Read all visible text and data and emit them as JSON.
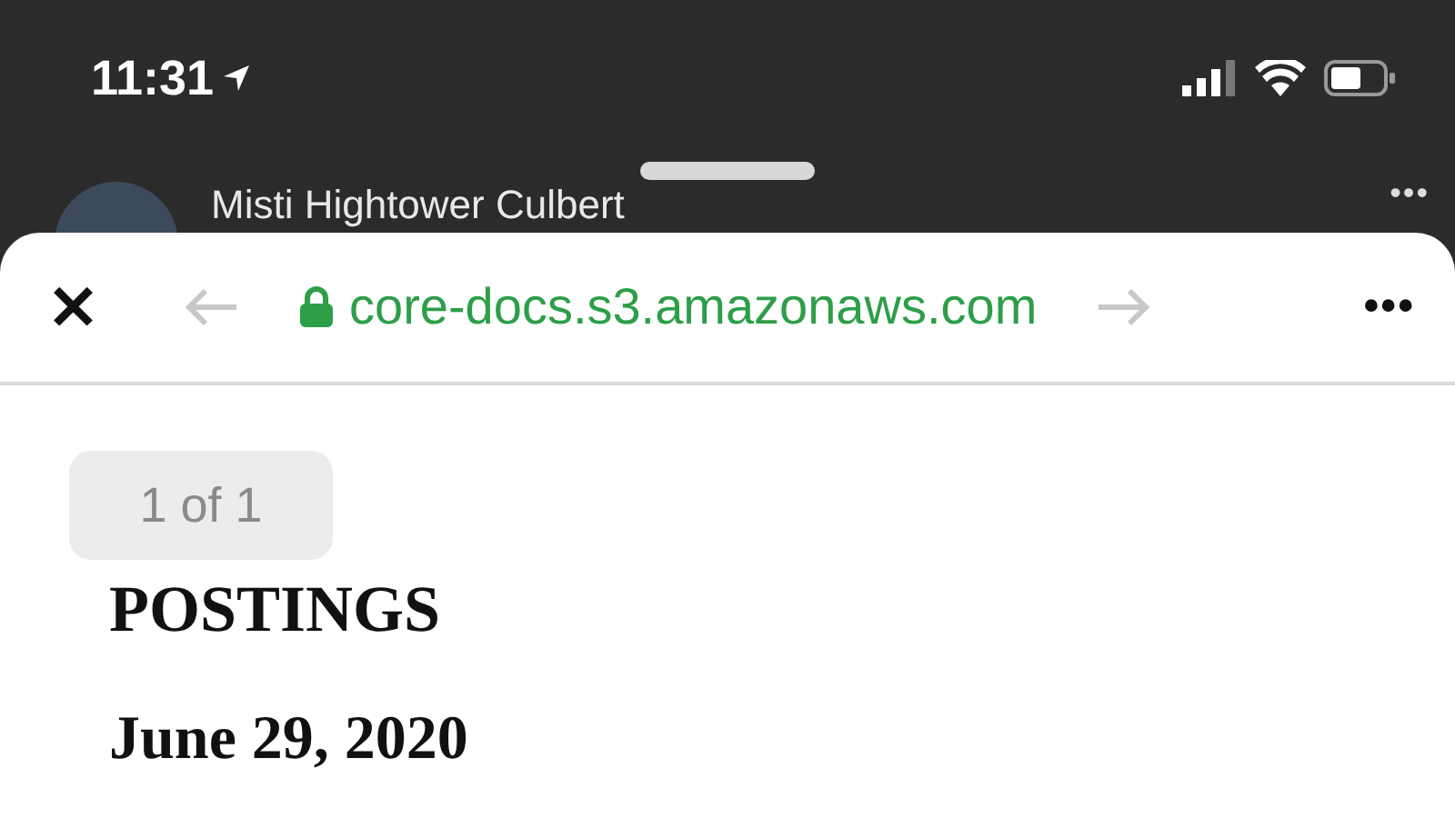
{
  "status_bar": {
    "time": "11:31"
  },
  "behind": {
    "name": "Misti Hightower Culbert",
    "more": "•••"
  },
  "browser": {
    "close": "✕",
    "url": "core-docs.s3.amazonaws.com",
    "back_disabled": true,
    "forward_disabled": true,
    "more": "•••"
  },
  "document": {
    "page_indicator": "1 of 1",
    "heading": "POSTINGS",
    "date": "June 29, 2020"
  }
}
